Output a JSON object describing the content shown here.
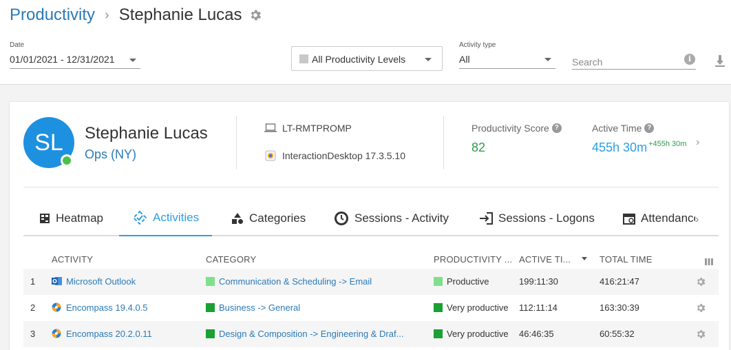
{
  "breadcrumb": {
    "root": "Productivity",
    "current": "Stephanie Lucas"
  },
  "filters": {
    "date_label": "Date",
    "date_value": "01/01/2021 - 12/31/2021",
    "productivity_level": "All Productivity Levels",
    "activity_type_label": "Activity type",
    "activity_type_value": "All",
    "search_placeholder": "Search"
  },
  "user": {
    "initials": "SL",
    "name": "Stephanie Lucas",
    "group": "Ops (NY)",
    "status_color": "#4cc04c",
    "avatar_color": "#1e90e0"
  },
  "device": {
    "computer": "LT-RMTPROMP",
    "app": "InteractionDesktop 17.3.5.10"
  },
  "metrics": {
    "score_label": "Productivity Score",
    "score_value": "82",
    "time_label": "Active Time",
    "time_value": "455h 30m",
    "time_delta": "+455h 30m"
  },
  "tabs": [
    {
      "label": "Heatmap",
      "icon": "heatmap-icon"
    },
    {
      "label": "Activities",
      "icon": "activities-icon",
      "active": true
    },
    {
      "label": "Categories",
      "icon": "categories-icon"
    },
    {
      "label": "Sessions - Activity",
      "icon": "clock-icon"
    },
    {
      "label": "Sessions - Logons",
      "icon": "login-icon"
    },
    {
      "label": "Attendance",
      "icon": "attendance-icon"
    }
  ],
  "table": {
    "headers": {
      "activity": "ACTIVITY",
      "category": "CATEGORY",
      "productivity": "PRODUCTIVITY ...",
      "active_time": "ACTIVE TI...",
      "total_time": "TOTAL TIME"
    },
    "rows": [
      {
        "num": "1",
        "activity": "Microsoft Outlook",
        "app_icon": "outlook-icon",
        "category": "Communication & Scheduling -> Email",
        "category_color": "#7fe08a",
        "productivity": "Productive",
        "productivity_color": "#7fe08a",
        "active_time": "199:11:30",
        "total_time": "416:21:47"
      },
      {
        "num": "2",
        "activity": "Encompass 19.4.0.5",
        "app_icon": "encompass-icon",
        "category": "Business -> General",
        "category_color": "#1aa033",
        "productivity": "Very productive",
        "productivity_color": "#1aa033",
        "active_time": "112:11:14",
        "total_time": "163:30:39"
      },
      {
        "num": "3",
        "activity": "Encompass 20.2.0.11",
        "app_icon": "encompass-icon",
        "category": "Design & Composition -> Engineering & Draf...",
        "category_color": "#1aa033",
        "productivity": "Very productive",
        "productivity_color": "#1aa033",
        "active_time": "46:46:35",
        "total_time": "60:55:32"
      }
    ]
  }
}
